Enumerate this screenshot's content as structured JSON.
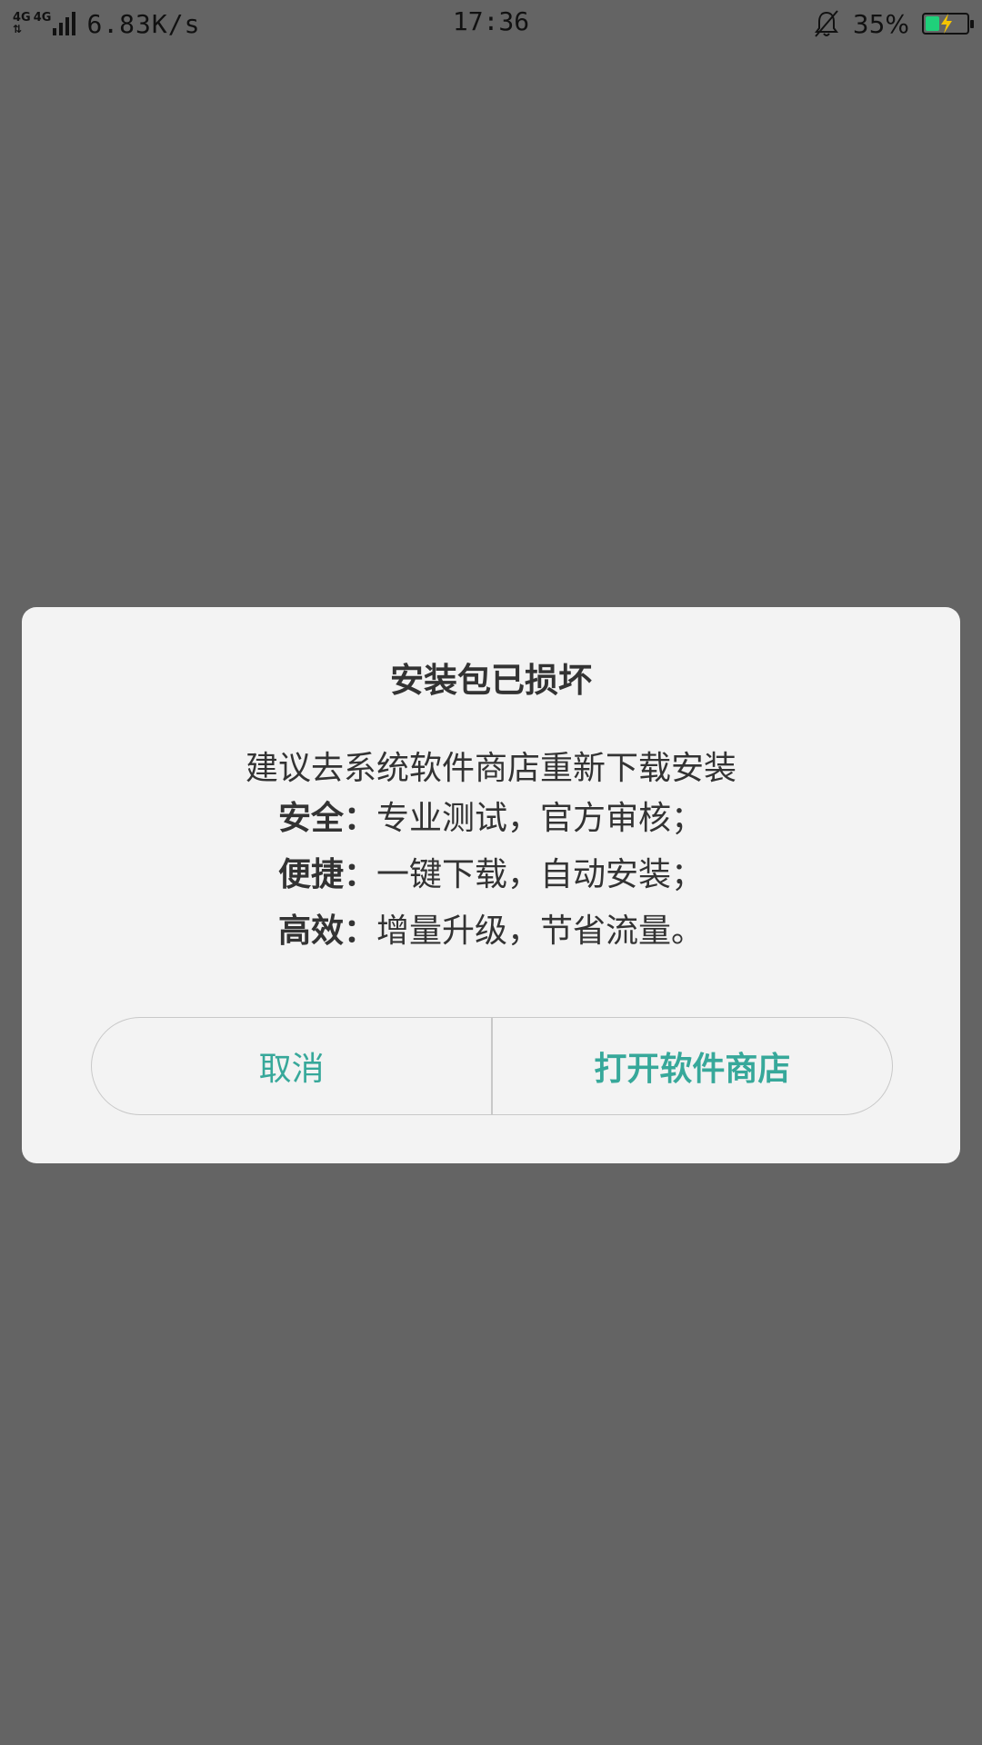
{
  "status_bar": {
    "network_labels": [
      "4G",
      "4G"
    ],
    "speed": "6.83K/s",
    "time": "17:36",
    "battery_percent": "35%",
    "battery_level": 0.35,
    "battery_color": "#1fd07a"
  },
  "dialog": {
    "title": "安装包已损坏",
    "subtitle": "建议去系统软件商店重新下载安装",
    "features": [
      {
        "label": "安全：",
        "text": "专业测试，官方审核；"
      },
      {
        "label": "便捷：",
        "text": "一键下载，自动安装；"
      },
      {
        "label": "高效：",
        "text": "增量升级，节省流量。"
      }
    ],
    "cancel_label": "取消",
    "open_store_label": "打开软件商店",
    "accent_color": "#37a89a"
  }
}
